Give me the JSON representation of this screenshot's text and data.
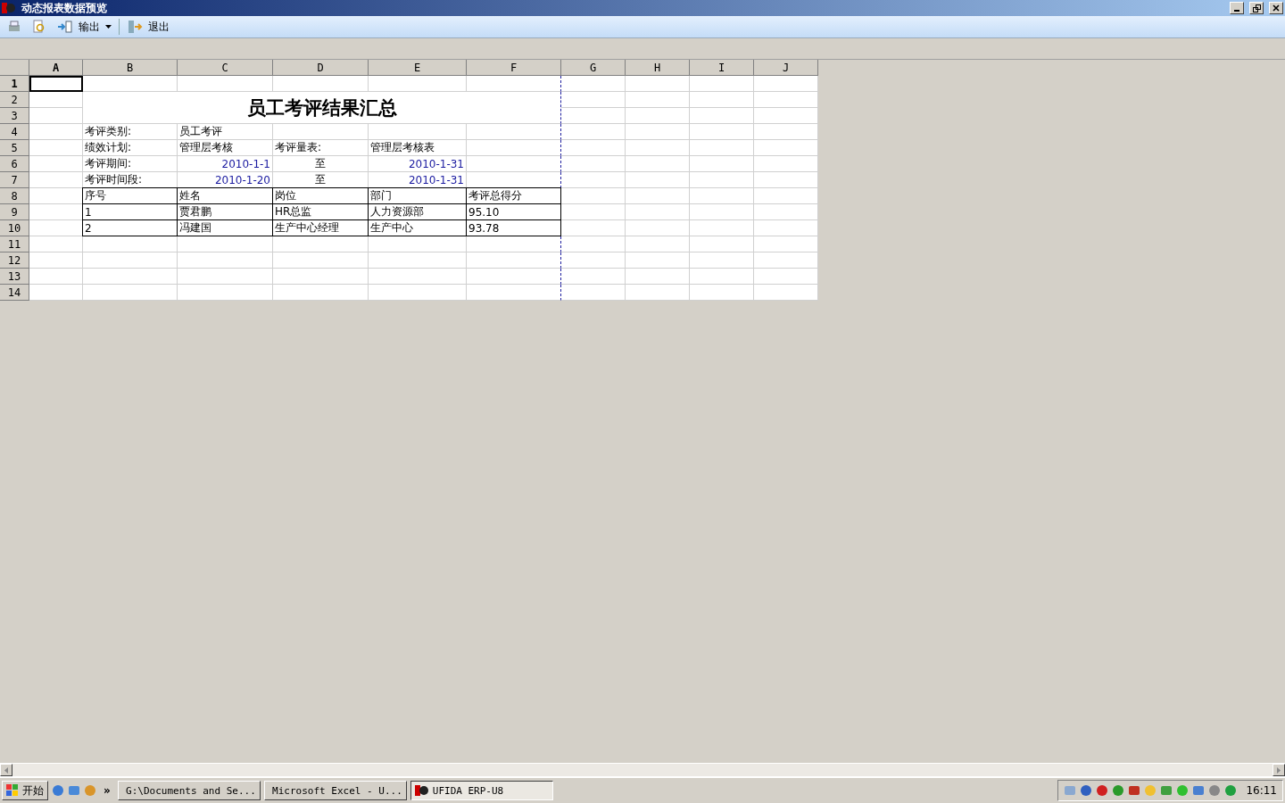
{
  "window": {
    "title": "动态报表数据预览"
  },
  "toolbar": {
    "items": [
      {
        "kind": "print"
      },
      {
        "kind": "preview"
      },
      {
        "kind": "export",
        "label": "输出"
      },
      {
        "kind": "separator"
      },
      {
        "kind": "exit",
        "label": "退出"
      }
    ]
  },
  "sheet": {
    "columns": [
      {
        "label": "A",
        "selected": true
      },
      {
        "label": "B",
        "selected": false
      },
      {
        "label": "C",
        "selected": false
      },
      {
        "label": "D",
        "selected": false
      },
      {
        "label": "E",
        "selected": false
      },
      {
        "label": "F",
        "selected": false
      },
      {
        "label": "G",
        "selected": false
      },
      {
        "label": "H",
        "selected": false
      },
      {
        "label": "I",
        "selected": false
      },
      {
        "label": "J",
        "selected": false
      }
    ],
    "rows": [
      {
        "number": "1",
        "selected": true
      },
      {
        "number": "2",
        "selected": false,
        "cells": [
          {
            "text": ""
          },
          {
            "kind": "title",
            "text": "员工考评结果汇总"
          }
        ]
      },
      {
        "number": "3",
        "selected": false
      },
      {
        "number": "4",
        "selected": false,
        "cells": [
          {
            "text": ""
          },
          {
            "kind": "text",
            "text": "考评类别:"
          },
          {
            "kind": "text",
            "text": "员工考评"
          }
        ]
      },
      {
        "number": "5",
        "selected": false,
        "cells": [
          {
            "text": ""
          },
          {
            "kind": "text",
            "text": "绩效计划:"
          },
          {
            "kind": "text",
            "text": "管理层考核"
          },
          {
            "kind": "text",
            "text": "考评量表:"
          },
          {
            "kind": "text",
            "text": "管理层考核表"
          }
        ]
      },
      {
        "number": "6",
        "selected": false,
        "cells": [
          {
            "text": ""
          },
          {
            "kind": "text",
            "text": "考评期间:"
          },
          {
            "kind": "date",
            "text": "2010-1-1"
          },
          {
            "kind": "center",
            "text": "至"
          },
          {
            "kind": "date",
            "text": "2010-1-31"
          }
        ]
      },
      {
        "number": "7",
        "selected": false,
        "cells": [
          {
            "text": ""
          },
          {
            "kind": "text",
            "text": "考评时间段:"
          },
          {
            "kind": "date",
            "text": "2010-1-20"
          },
          {
            "kind": "center",
            "text": "至"
          },
          {
            "kind": "date",
            "text": "2010-1-31"
          }
        ]
      },
      {
        "number": "8",
        "selected": false,
        "cells": [
          {
            "text": ""
          },
          {
            "kind": "table",
            "text": "序号"
          },
          {
            "kind": "table",
            "text": "姓名"
          },
          {
            "kind": "table",
            "text": "岗位"
          },
          {
            "kind": "table",
            "text": "部门"
          },
          {
            "kind": "table",
            "text": "考评总得分"
          }
        ]
      },
      {
        "number": "9",
        "selected": false,
        "cells": [
          {
            "text": ""
          },
          {
            "kind": "table",
            "text": "1"
          },
          {
            "kind": "table",
            "text": "贾君鹏"
          },
          {
            "kind": "table",
            "text": "HR总监"
          },
          {
            "kind": "table",
            "text": "人力资源部"
          },
          {
            "kind": "table",
            "text": "95.10"
          }
        ]
      },
      {
        "number": "10",
        "selected": false,
        "cells": [
          {
            "text": ""
          },
          {
            "kind": "table",
            "text": "2"
          },
          {
            "kind": "table",
            "text": "冯建国"
          },
          {
            "kind": "table",
            "text": "生产中心经理"
          },
          {
            "kind": "table",
            "text": "生产中心"
          },
          {
            "kind": "table",
            "text": "93.78"
          }
        ]
      },
      {
        "number": "11",
        "selected": false
      },
      {
        "number": "12",
        "selected": false
      },
      {
        "number": "13",
        "selected": false
      },
      {
        "number": "14",
        "selected": false
      }
    ]
  },
  "taskbar": {
    "start": "开始",
    "overflow": "»",
    "tasks": [
      {
        "kind": "folder",
        "label": "G:\\Documents and Se...",
        "selected": false
      },
      {
        "kind": "excel",
        "label": "Microsoft Excel - U...",
        "selected": false
      },
      {
        "kind": "ufida",
        "label": "UFIDA ERP-U8",
        "selected": true
      }
    ],
    "clock": "16:11"
  }
}
